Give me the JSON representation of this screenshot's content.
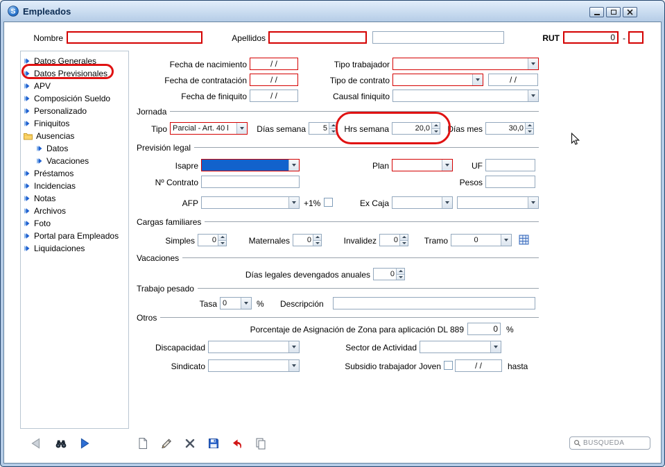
{
  "window": {
    "title": "Empleados"
  },
  "colors": {
    "required_border": "#d40000",
    "annotation": "#e01212",
    "selection_fill": "#1262cc",
    "titlebar_gradient_top": "#e2eefb",
    "titlebar_gradient_bottom": "#b5cce6"
  },
  "icons": {
    "logo": "S",
    "minimize": "minimize-bar",
    "maximize": "restore-box",
    "close": "x-cross",
    "nav_prev": "left-triangle",
    "nav_find": "binoculars",
    "nav_next": "right-triangle",
    "new": "blank-page",
    "edit": "pencil",
    "delete": "x-cross",
    "save": "floppy-disk",
    "undo": "red-curved-arrow",
    "copy": "two-pages",
    "search": "magnifier",
    "tramo_table": "blue-grid",
    "tree_item": "blue-arrow",
    "folder": "yellow-folder"
  },
  "header": {
    "nombre_label": "Nombre",
    "apellidos_label": "Apellidos",
    "rut_label": "RUT",
    "rut_value": "0",
    "dash": "-"
  },
  "sidebar": {
    "items": [
      {
        "label": "Datos Generales"
      },
      {
        "label": "Datos Previsionales",
        "selected": true
      },
      {
        "label": "APV"
      },
      {
        "label": "Composición Sueldo"
      },
      {
        "label": "Personalizado"
      },
      {
        "label": "Finiquitos"
      },
      {
        "label": "Ausencias"
      },
      {
        "label": "Datos"
      },
      {
        "label": "Vacaciones"
      },
      {
        "label": "Préstamos"
      },
      {
        "label": "Incidencias"
      },
      {
        "label": "Notas"
      },
      {
        "label": "Archivos"
      },
      {
        "label": "Foto"
      },
      {
        "label": "Portal para Empleados"
      },
      {
        "label": "Liquidaciones"
      }
    ]
  },
  "form": {
    "fechas": {
      "nacimiento_label": "Fecha de nacimiento",
      "nacimiento_value": "/ /",
      "tipo_trabajador_label": "Tipo trabajador",
      "contratacion_label": "Fecha de contratación",
      "contratacion_value": "/ /",
      "tipo_contrato_label": "Tipo de contrato",
      "tipo_contrato_fecha": "/ /",
      "finiquito_label": "Fecha de finiquito",
      "finiquito_value": "/ /",
      "causal_label": "Causal finiquito"
    },
    "jornada": {
      "title": "Jornada",
      "tipo_label": "Tipo",
      "tipo_value": "Parcial - Art. 40 l",
      "dias_semana_label": "Días semana",
      "dias_semana_value": "5",
      "hrs_semana_label": "Hrs semana",
      "hrs_semana_value": "20,0",
      "dias_mes_label": "Días mes",
      "dias_mes_value": "30,0"
    },
    "prevision": {
      "title": "Previsión legal",
      "isapre_label": "Isapre",
      "plan_label": "Plan",
      "uf_label": "UF",
      "contrato_label": "Nº Contrato",
      "pesos_label": "Pesos",
      "afp_label": "AFP",
      "mas1_label": "+1%",
      "excaja_label": "Ex Caja"
    },
    "cargas": {
      "title": "Cargas familiares",
      "simples_label": "Simples",
      "simples_value": "0",
      "maternales_label": "Maternales",
      "maternales_value": "0",
      "invalidez_label": "Invalidez",
      "invalidez_value": "0",
      "tramo_label": "Tramo",
      "tramo_value": "0"
    },
    "vacaciones": {
      "title": "Vacaciones",
      "dias_label": "Días legales devengados anuales",
      "dias_value": "0"
    },
    "pesado": {
      "title": "Trabajo pesado",
      "tasa_label": "Tasa",
      "tasa_value": "0",
      "pct": "%",
      "desc_label": "Descripción"
    },
    "otros": {
      "title": "Otros",
      "zona_label": "Porcentaje de Asignación de Zona para aplicación DL 889",
      "zona_value": "0",
      "pct": "%",
      "discapacidad_label": "Discapacidad",
      "sector_label": "Sector de Actividad",
      "sindicato_label": "Sindicato",
      "subsidio_label": "Subsidio trabajador Joven",
      "subsidio_fecha": "/ /",
      "hasta_label": "hasta"
    }
  },
  "toolbar": {
    "search_placeholder": "BÚSQUEDA"
  }
}
